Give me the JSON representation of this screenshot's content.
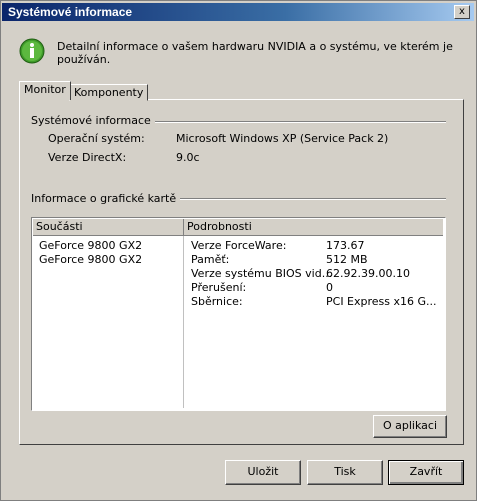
{
  "window": {
    "title": "Systémové informace",
    "close_label": "x"
  },
  "header": {
    "text": "Detailní informace o vašem hardwaru NVIDIA a o systému, ve kterém je používán."
  },
  "tabs": [
    {
      "label": "Monitor"
    },
    {
      "label": "Komponenty"
    }
  ],
  "system_group": {
    "title": "Systémové informace",
    "rows": [
      {
        "label": "Operační systém:",
        "value": "Microsoft Windows XP (Service Pack 2)"
      },
      {
        "label": "Verze DirectX:",
        "value": "9.0c"
      }
    ]
  },
  "gpu_group": {
    "title": "Informace o grafické kartě",
    "columns": [
      "Součásti",
      "Podrobnosti"
    ],
    "components": [
      "GeForce 9800 GX2",
      "GeForce 9800 GX2"
    ],
    "details": [
      {
        "label": "Verze ForceWare:",
        "value": "173.67"
      },
      {
        "label": "Paměť:",
        "value": "512 MB"
      },
      {
        "label": "Verze systému BIOS vid...",
        "value": "62.92.39.00.10"
      },
      {
        "label": "Přerušení:",
        "value": "0"
      },
      {
        "label": "Sběrnice:",
        "value": "PCI Express x16 G..."
      }
    ]
  },
  "buttons": {
    "about": "O aplikaci",
    "save": "Uložit",
    "print": "Tisk",
    "close": "Zavřít"
  },
  "colors": {
    "titlebar_start": "#0a246a",
    "titlebar_end": "#a6caf0",
    "icon_green": "#3f9b2a"
  }
}
